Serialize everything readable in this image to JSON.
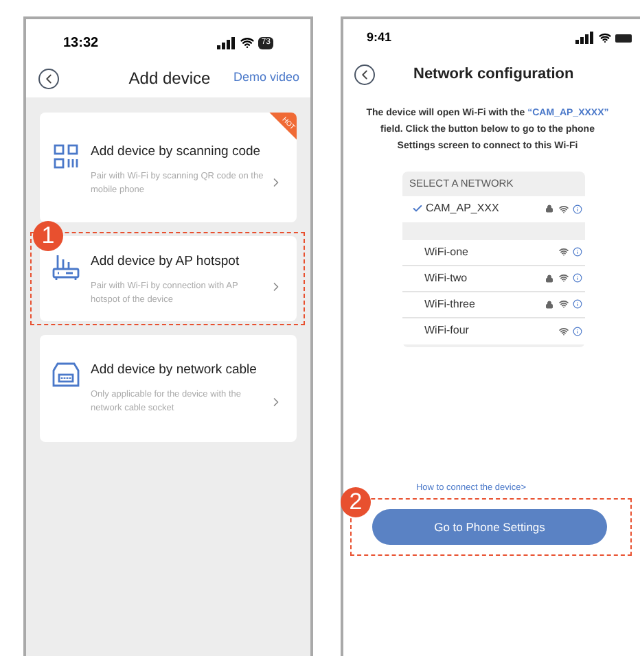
{
  "left_screen": {
    "status_bar": {
      "time": "13:32",
      "battery": "73"
    },
    "header": {
      "title": "Add device",
      "action": "Demo video"
    },
    "cards": [
      {
        "kind": "qr",
        "title": "Add device by scanning code",
        "description": "Pair with Wi-Fi by scanning QR code on the mobile phone",
        "hot_label": "HOT"
      },
      {
        "kind": "router",
        "title": "Add device by AP hotspot",
        "description": "Pair with Wi-Fi by connection with AP hotspot of the device",
        "step": "1"
      },
      {
        "kind": "cable",
        "title": "Add device by network cable",
        "description": "Only applicable for the device with the network cable socket"
      }
    ]
  },
  "right_screen": {
    "status_bar": {
      "time": "9:41"
    },
    "header": {
      "title": "Network configuration"
    },
    "message": {
      "before": "The device will open Wi-Fi with the",
      "highlight": "“CAM_AP_XXXX”",
      "after": "field. Click the button below to go to the phone Settings screen to connect to this Wi-Fi"
    },
    "network_list": {
      "heading": "SELECT A NETWORK",
      "current": {
        "name": "CAM_AP_XXX",
        "selected": true,
        "locked": true
      },
      "networks": [
        {
          "name": "WiFi-one",
          "selected": false,
          "locked": false
        },
        {
          "name": "WiFi-two",
          "selected": false,
          "locked": true
        },
        {
          "name": "WiFi-three",
          "selected": false,
          "locked": true
        },
        {
          "name": "WiFi-four",
          "selected": false,
          "locked": false
        }
      ]
    },
    "help_link": "How to connect the device>",
    "button": "Go to Phone Settings",
    "step": "2"
  }
}
